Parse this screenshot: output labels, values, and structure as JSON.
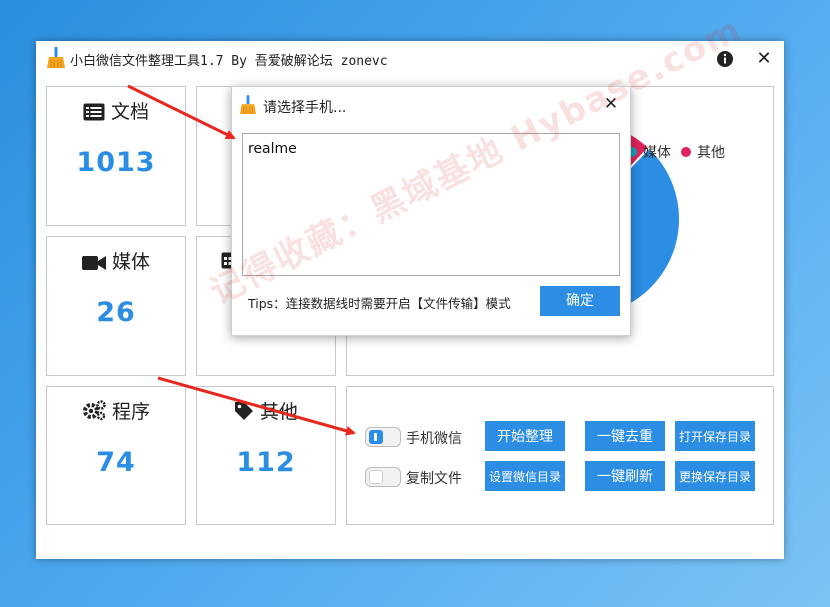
{
  "window": {
    "title": "小白微信文件整理工具1.7 By 吾爱破解论坛 zonevc",
    "info_icon": "info-circle-icon",
    "close_icon": "close-icon"
  },
  "stats": [
    {
      "label": "文档",
      "value": "1013",
      "icon": "document-list-icon"
    },
    {
      "label": "",
      "value": "",
      "icon": "hidden-behind-dialog"
    },
    {
      "label": "媒体",
      "value": "26",
      "icon": "video-camera-icon"
    },
    {
      "label": "",
      "value": "",
      "icon": "calendar-icon"
    },
    {
      "label": "程序",
      "value": "74",
      "icon": "gears-icon"
    },
    {
      "label": "其他",
      "value": "112",
      "icon": "tag-icon"
    }
  ],
  "chart_data": {
    "type": "pie",
    "legend": [
      {
        "name": "媒体",
        "color": "#17a2b8"
      },
      {
        "name": "其他",
        "color": "#e0245e"
      }
    ],
    "slices": [
      {
        "name": "媒体",
        "value": 26,
        "color": "#17a2b8"
      },
      {
        "name": "其他",
        "value": 112,
        "color": "#e0245e"
      },
      {
        "name": "文档",
        "value": 1013,
        "color": "#2b8de3"
      }
    ]
  },
  "controls": {
    "toggles": [
      {
        "label": "手机微信",
        "state": "on"
      },
      {
        "label": "复制文件",
        "state": "off"
      }
    ],
    "buttons": {
      "start": "开始整理",
      "dedupe": "一键去重",
      "open_dir": "打开保存目录",
      "set_wechat_dir": "设置微信目录",
      "refresh": "一键刷新",
      "change_dir": "更换保存目录"
    }
  },
  "dialog": {
    "title": "请选择手机...",
    "textarea_value": "realme",
    "tips": "Tips：连接数据线时需要开启【文件传输】模式",
    "ok_label": "确定"
  },
  "watermark": "记得收藏：黑域基地 Hybase.com",
  "colors": {
    "accent": "#2b8de3",
    "legend_media": "#17a2b8",
    "legend_other": "#e0245e",
    "annotation_arrow": "#e8281e"
  }
}
